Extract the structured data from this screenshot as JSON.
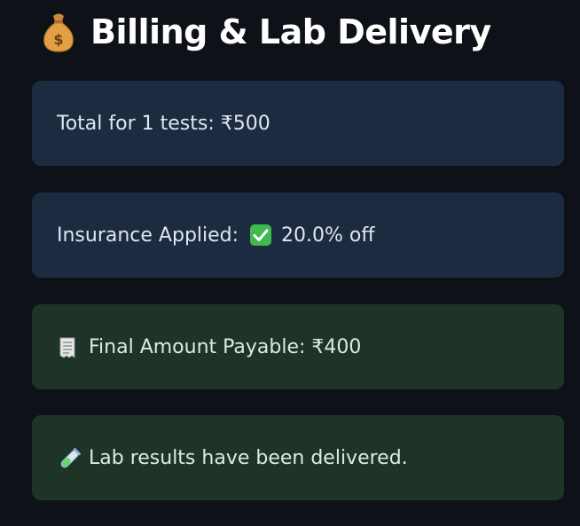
{
  "header": {
    "icon": "money-bag-icon",
    "title": "Billing & Lab Delivery"
  },
  "cards": {
    "total": {
      "text": "Total for 1 tests: ₹500",
      "style": "info"
    },
    "insurance": {
      "label": "Insurance Applied:",
      "icon": "check-mark-icon",
      "value": "20.0% off",
      "style": "info"
    },
    "final_amount": {
      "icon": "receipt-icon",
      "text": "Final Amount Payable: ₹400",
      "style": "success"
    },
    "lab_results": {
      "icon": "test-tube-icon",
      "text": "Lab results have been delivered.",
      "style": "success"
    }
  },
  "colors": {
    "background": "#0e1117",
    "info_card": "#1c2b40",
    "success_card": "#1d3427",
    "check_green": "#3fb950"
  }
}
